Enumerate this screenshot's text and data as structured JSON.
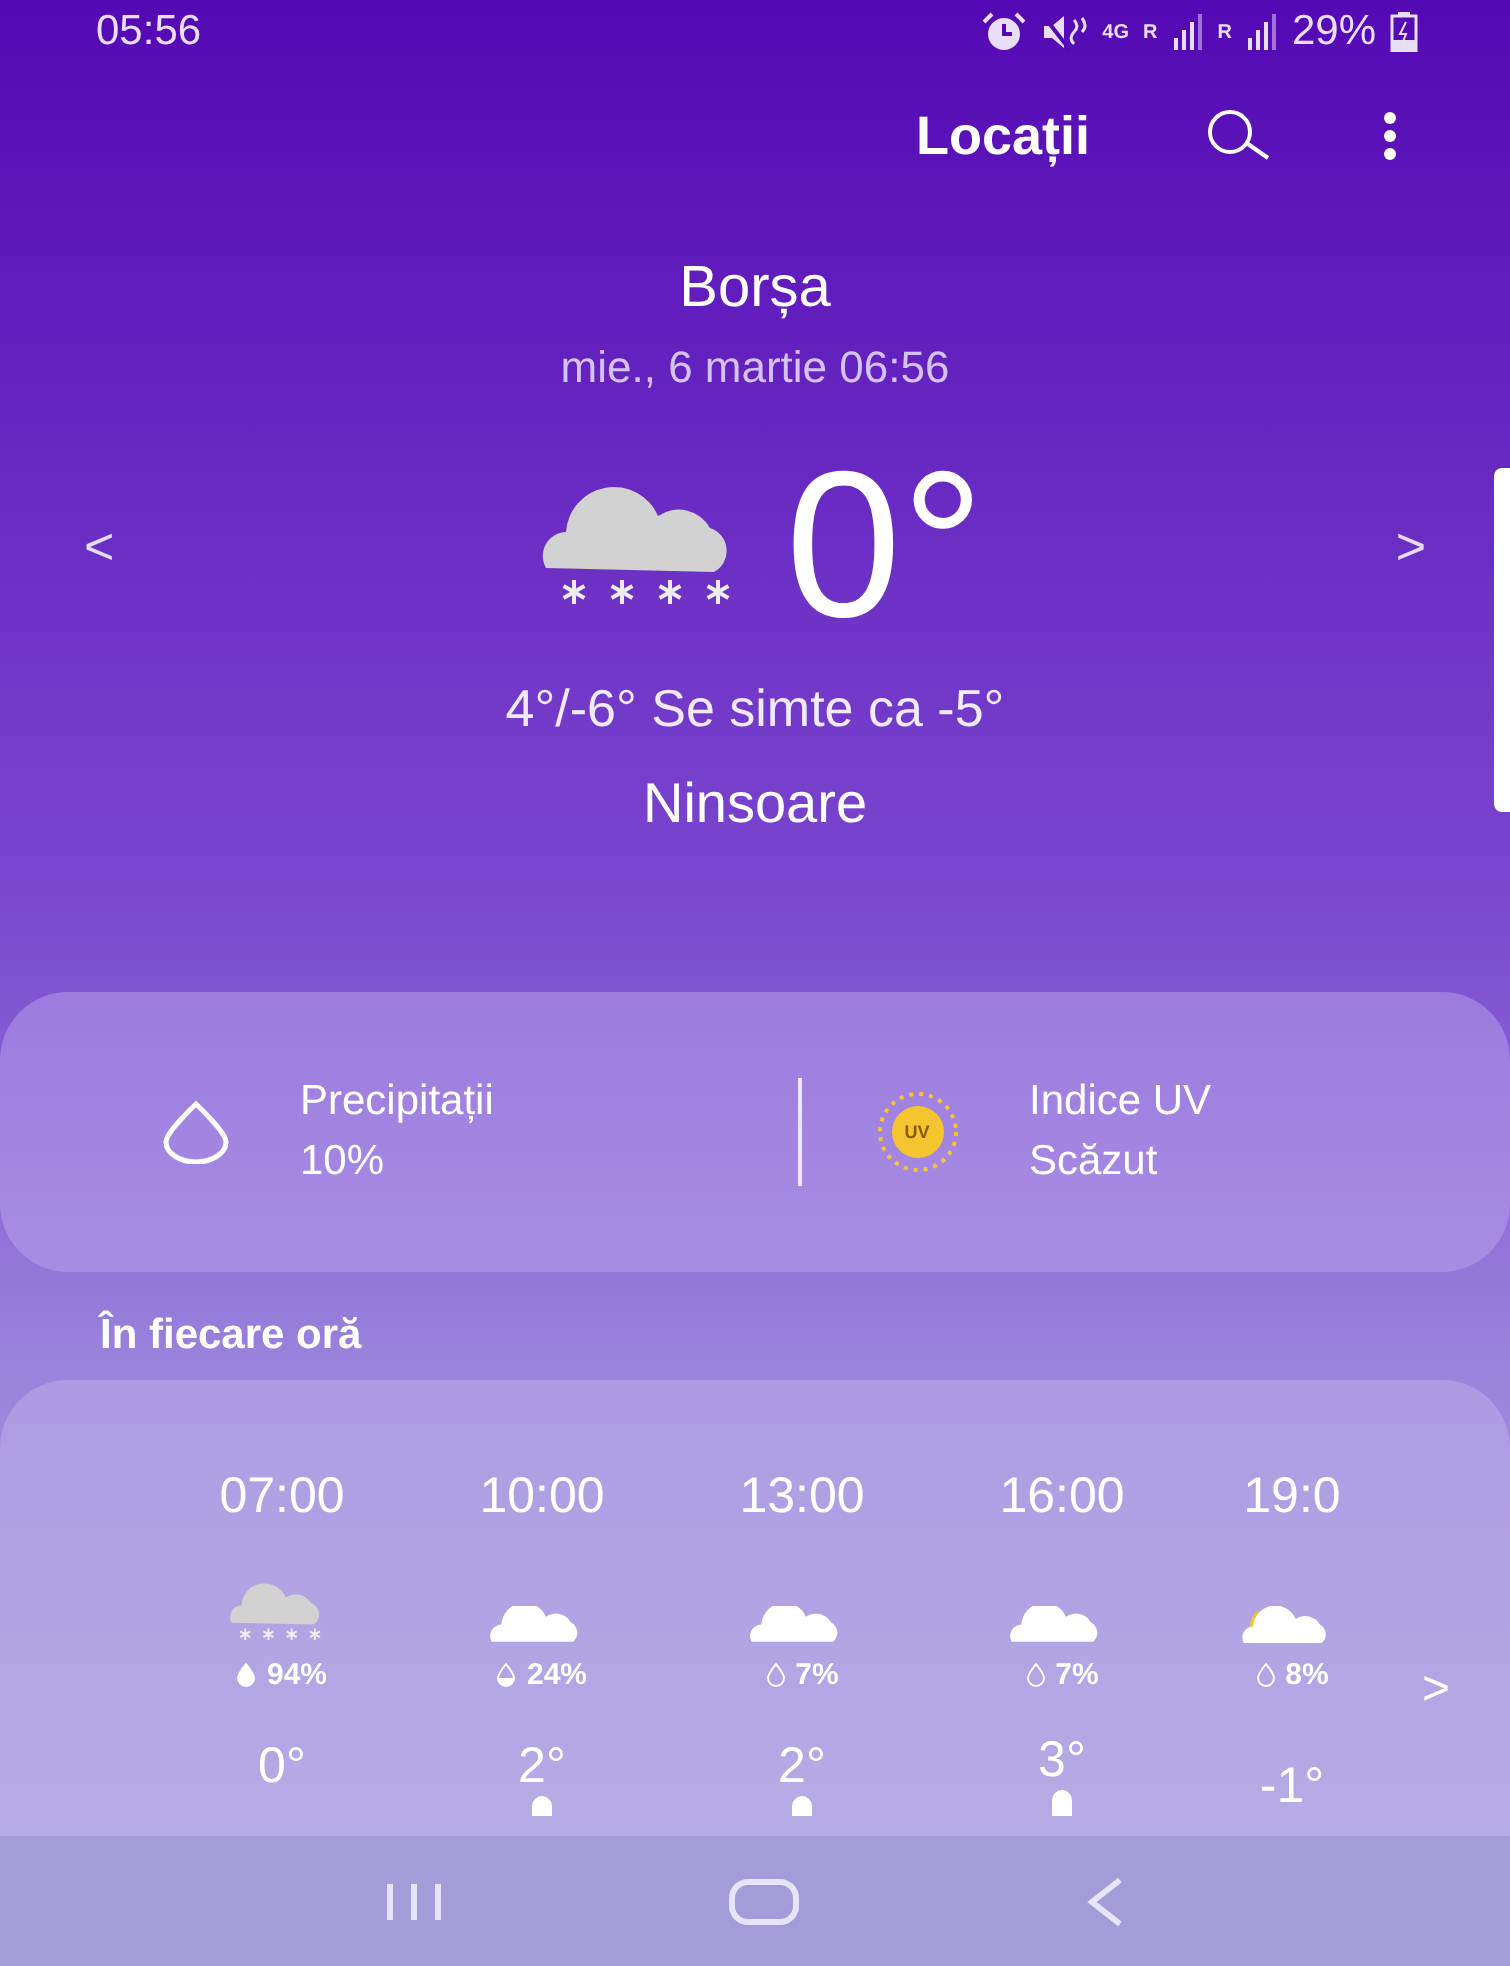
{
  "status_bar": {
    "time": "05:56",
    "network": "4G",
    "sim_labels": [
      "R",
      "R"
    ],
    "battery": "29%"
  },
  "header": {
    "title": "Locații"
  },
  "current": {
    "city": "Borșa",
    "date": "mie., 6 martie 06:56",
    "temperature": "0°",
    "kind": "snow",
    "feels": "4°/-6° Se simte ca -5°",
    "condition": "Ninsoare",
    "prev": "<",
    "next": ">"
  },
  "details": [
    {
      "kind": "drop",
      "label": "Precipitații",
      "value": "10%"
    },
    {
      "kind": "uv",
      "badge": "UV",
      "label": "Indice UV",
      "value": "Scăzut"
    }
  ],
  "hourly": {
    "title": "În fiecare oră",
    "next": ">",
    "hours": [
      {
        "time": "07:00",
        "kind": "snow",
        "precip": {
          "kind": "full",
          "value": "94%"
        },
        "temp": "0°"
      },
      {
        "time": "10:00",
        "kind": "cloud",
        "precip": {
          "kind": "half",
          "value": "24%"
        },
        "temp": "2°"
      },
      {
        "time": "13:00",
        "kind": "cloud",
        "precip": {
          "kind": "empty",
          "value": "7%"
        },
        "temp": "2°"
      },
      {
        "time": "16:00",
        "kind": "cloud",
        "precip": {
          "kind": "empty",
          "value": "7%"
        },
        "temp": "3°"
      },
      {
        "time": "19:0",
        "kind": "moon",
        "precip": {
          "kind": "empty",
          "value": "8%"
        },
        "temp": "-1°"
      }
    ]
  }
}
